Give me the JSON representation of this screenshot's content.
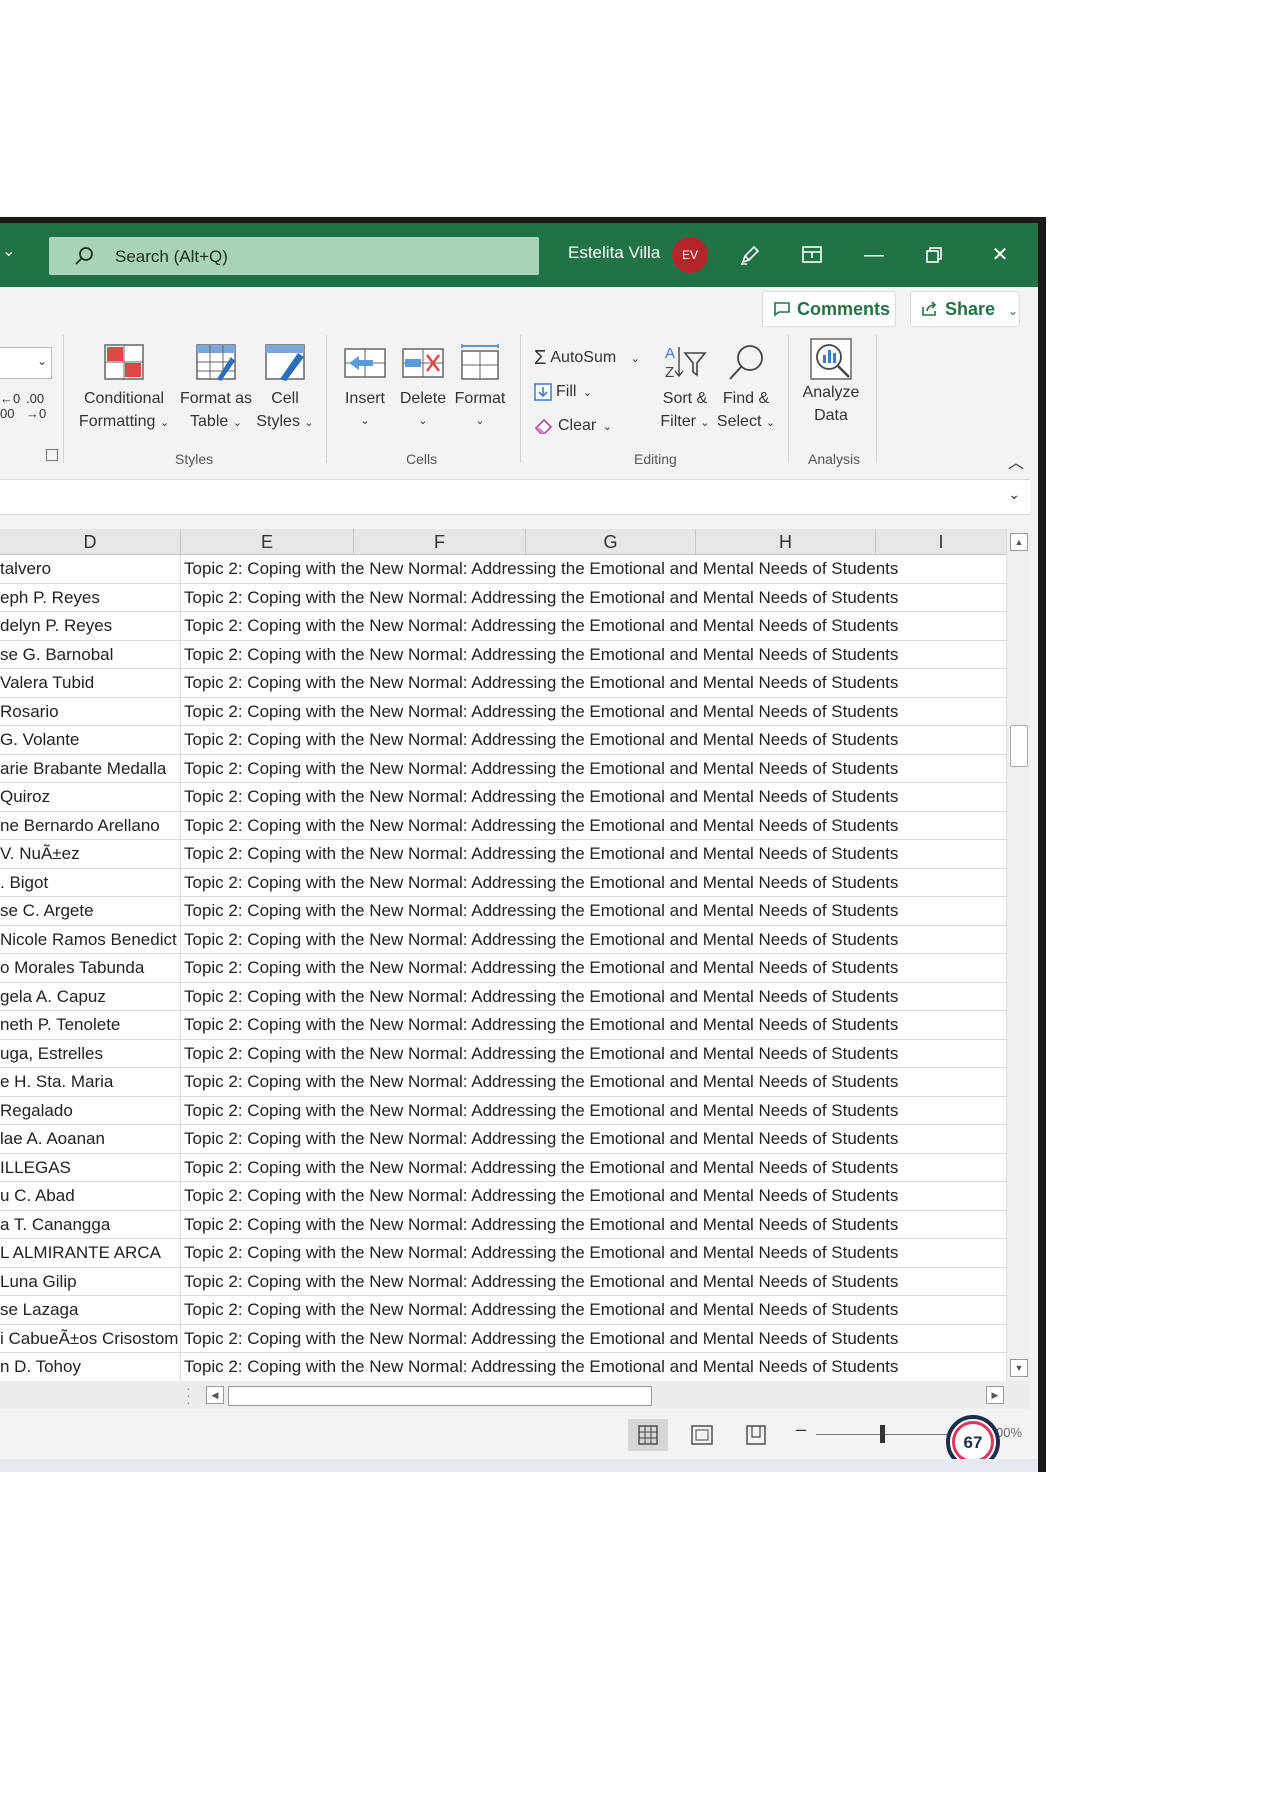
{
  "titlebar": {
    "search_placeholder": "Search (Alt+Q)",
    "user_name": "Estelita Villa",
    "user_initials": "EV"
  },
  "actions": {
    "comments_label": "Comments",
    "share_label": "Share"
  },
  "ribbon": {
    "styles": {
      "label": "Styles",
      "conditional_formatting": [
        "Conditional",
        "Formatting"
      ],
      "format_as_table": [
        "Format as",
        "Table"
      ],
      "cell_styles": [
        "Cell",
        "Styles"
      ]
    },
    "cells": {
      "label": "Cells",
      "insert": "Insert",
      "delete": "Delete",
      "format": "Format"
    },
    "editing": {
      "label": "Editing",
      "autosum": "AutoSum",
      "fill": "Fill",
      "clear": "Clear",
      "sort_filter": [
        "Sort &",
        "Filter"
      ],
      "find_select": [
        "Find &",
        "Select"
      ]
    },
    "analysis": {
      "label": "Analysis",
      "analyze_data": [
        "Analyze",
        "Data"
      ]
    }
  },
  "columns": [
    "D",
    "E",
    "F",
    "G",
    "H",
    "I"
  ],
  "topic_text": "Topic 2: Coping with the New Normal: Addressing the Emotional and Mental Needs of Students",
  "rows": [
    "talvero",
    "eph P. Reyes",
    "delyn P. Reyes",
    "se G. Barnobal",
    "Valera Tubid",
    "Rosario",
    "G. Volante",
    "arie Brabante Medalla",
    "Quiroz",
    "ne Bernardo Arellano",
    "V. NuÃ±ez",
    ". Bigot",
    "se C. Argete",
    "Nicole Ramos Benedict",
    "o Morales Tabunda",
    "gela A. Capuz",
    "neth P. Tenolete",
    "uga, Estrelles",
    "e H. Sta. Maria",
    "Regalado",
    "lae A. Aoanan",
    "ILLEGAS",
    "u C. Abad",
    "a T. Canangga",
    "L ALMIRANTE ARCA",
    "Luna Gilip",
    "se Lazaga",
    "i CabueÃ±os Crisostom",
    "n D. Tohoy"
  ],
  "statusbar": {
    "zoom_badge": "67",
    "zoom_pct": "00%"
  }
}
